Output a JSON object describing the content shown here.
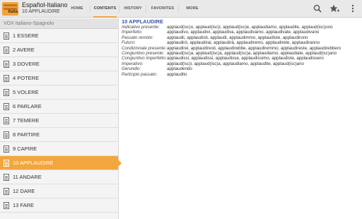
{
  "app": {
    "title": "Español-Italiano",
    "subtitle": "10 APPLAUDIRE",
    "icon_label": "Italia"
  },
  "tabs": [
    {
      "label": "HOME",
      "active": false
    },
    {
      "label": "CONTENTS",
      "active": true
    },
    {
      "label": "HISTORY",
      "active": false
    },
    {
      "label": "FAVORITES",
      "active": false
    },
    {
      "label": "MORE",
      "active": false
    }
  ],
  "actions": {
    "search": "search-icon",
    "favorite": "star-add-icon",
    "overflow": "overflow-menu-icon"
  },
  "sidebar": {
    "header": "VOX Italiano-Spagnolo",
    "items": [
      {
        "label": "1 ESSERE"
      },
      {
        "label": "2 AVERE"
      },
      {
        "label": "3 DOVERE"
      },
      {
        "label": "4 POTERE"
      },
      {
        "label": "5 VOLERE"
      },
      {
        "label": "6 PARLARE"
      },
      {
        "label": "7 TEMERE"
      },
      {
        "label": "8 PARTIRE"
      },
      {
        "label": "9 CAPIRE"
      },
      {
        "label": "10 APPLAUDIRE",
        "selected": true
      },
      {
        "label": "11 ANDARE"
      },
      {
        "label": "12 DARE"
      },
      {
        "label": "13 FARE"
      }
    ]
  },
  "content": {
    "title": "10 APPLAUDIRE",
    "rows": [
      {
        "label": "Indicativo presente:",
        "value": "applaud(isc)o, applaud(isc)i, applaud(isc)e, applaudiamo, applaudite, applaud(isc)ono"
      },
      {
        "label": "Imperfetto:",
        "value": "applaudivo, applaudivi, applaudiva, applaudivamo, applaudivate, applaudivano"
      },
      {
        "label": "Passato remoto:",
        "value": "applaudii, applaudisti, applaudi, applaudimmo, applaudiste, applaudirono"
      },
      {
        "label": "Futuro:",
        "value": "applaudirò, applaudirai, applaudirà, applaudiremo, applaudirete, applaudiranno"
      },
      {
        "label": "Condizionale presente:",
        "value": "applaudirei, applaudiresti, applaudirebbe, applaudiremmo, applaudireste, applaudirebbero"
      },
      {
        "label": "Congiuntivo presente:",
        "value": "applaud(isc)a, applaud(isc)a, applaud(isc)a, applaudiamo, applaudiate, applaud(isc)ano"
      },
      {
        "label": "Congiuntivo imperfetto:",
        "value": "applaudissi, applaudissi, applaudisse, applaudissimo, applaudiste, applaudissero"
      },
      {
        "label": "Imperativo:",
        "value": "applaud(isc)i, applaud(isc)a, applaudiamo, applaudite, applaud(isc)ano"
      },
      {
        "label": "Gerundio:",
        "value": "applaudendo"
      },
      {
        "label": "Participio passato:",
        "value": "applaudito"
      }
    ]
  }
}
